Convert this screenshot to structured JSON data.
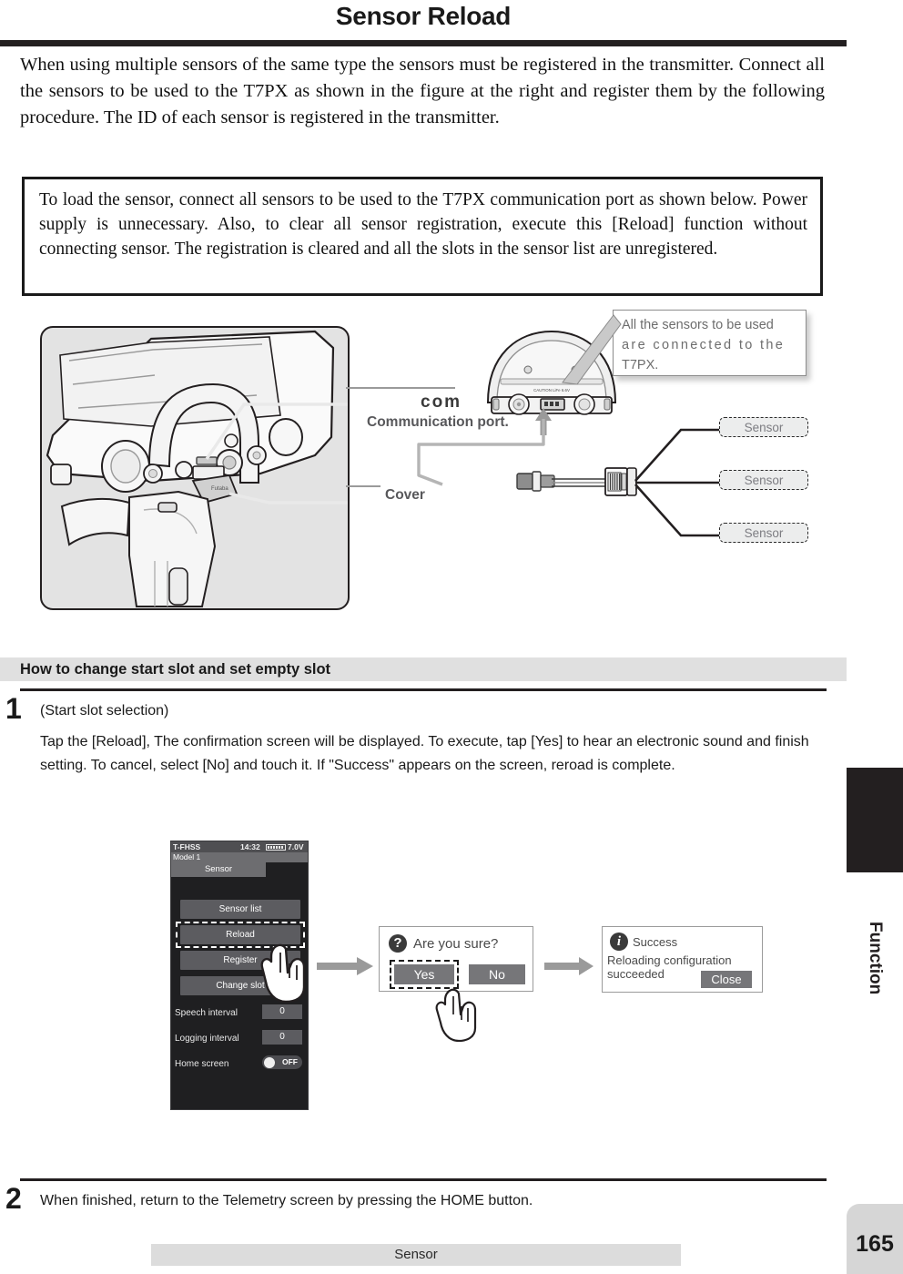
{
  "page": {
    "title": "Sensor Reload",
    "number": "165",
    "side_tab_label": "Function",
    "footer_label": "Sensor"
  },
  "intro": {
    "text": "When using multiple sensors of the same type the sensors must be registered in the transmitter. Connect all the sensors to be used to the T7PX as shown in the figure at the right and register them by the following procedure. The ID of each sensor is registered in the transmitter."
  },
  "note_box": {
    "text": "To load the sensor, connect all sensors to be used to the T7PX communication port as shown below. Power supply is unnecessary. Also, to clear all sensor registration, execute this [Reload] function without connecting sensor. The registration is cleared and all the slots in the sensor list are unregistered."
  },
  "figure": {
    "callout_lines": [
      "All the sensors to be used",
      "are connected to the",
      "T7PX."
    ],
    "com_logo": "com",
    "communication_port_label": "Communication port.",
    "cover_label": "Cover",
    "hub_brand": "Futaba",
    "sensor_labels": [
      "Sensor",
      "Sensor",
      "Sensor"
    ]
  },
  "section": {
    "band_title": "How to change start slot and set empty slot"
  },
  "steps": [
    {
      "number": "1",
      "subtitle": "(Start slot selection)",
      "body": "Tap the [Reload], The confirmation screen will be displayed. To execute, tap [Yes] to hear an electronic sound and finish setting. To cancel, select [No] and touch it. If \"Success\" appears on the screen, reroad is complete."
    },
    {
      "number": "2",
      "body": "When finished, return to the Telemetry screen by pressing the HOME button."
    }
  ],
  "lcd": {
    "status": {
      "system": "T-FHSS",
      "time": "14:32",
      "voltage": "7.0V"
    },
    "model": "Model 1",
    "tab": "Sensor",
    "buttons": [
      {
        "label": "Sensor list"
      },
      {
        "label": "Reload"
      },
      {
        "label": "Register"
      },
      {
        "label": "Change slot"
      }
    ],
    "rows": [
      {
        "label": "Speech interval",
        "value": "0"
      },
      {
        "label": "Logging interval",
        "value": "0"
      }
    ],
    "home_screen": {
      "label": "Home screen",
      "value": "OFF"
    }
  },
  "confirm_dialog": {
    "icon": "question-icon",
    "title": "Are you sure?",
    "yes_label": "Yes",
    "no_label": "No"
  },
  "success_dialog": {
    "icon": "info-icon",
    "title": "Success",
    "message": "Reloading configuration succeeded",
    "close_label": "Close"
  },
  "colors": {
    "ink": "#231f20",
    "band": "#e0e0e0",
    "lcd_bg": "#1f1f21",
    "lcd_button": "#5c5c60",
    "dialog_button": "#767679"
  }
}
